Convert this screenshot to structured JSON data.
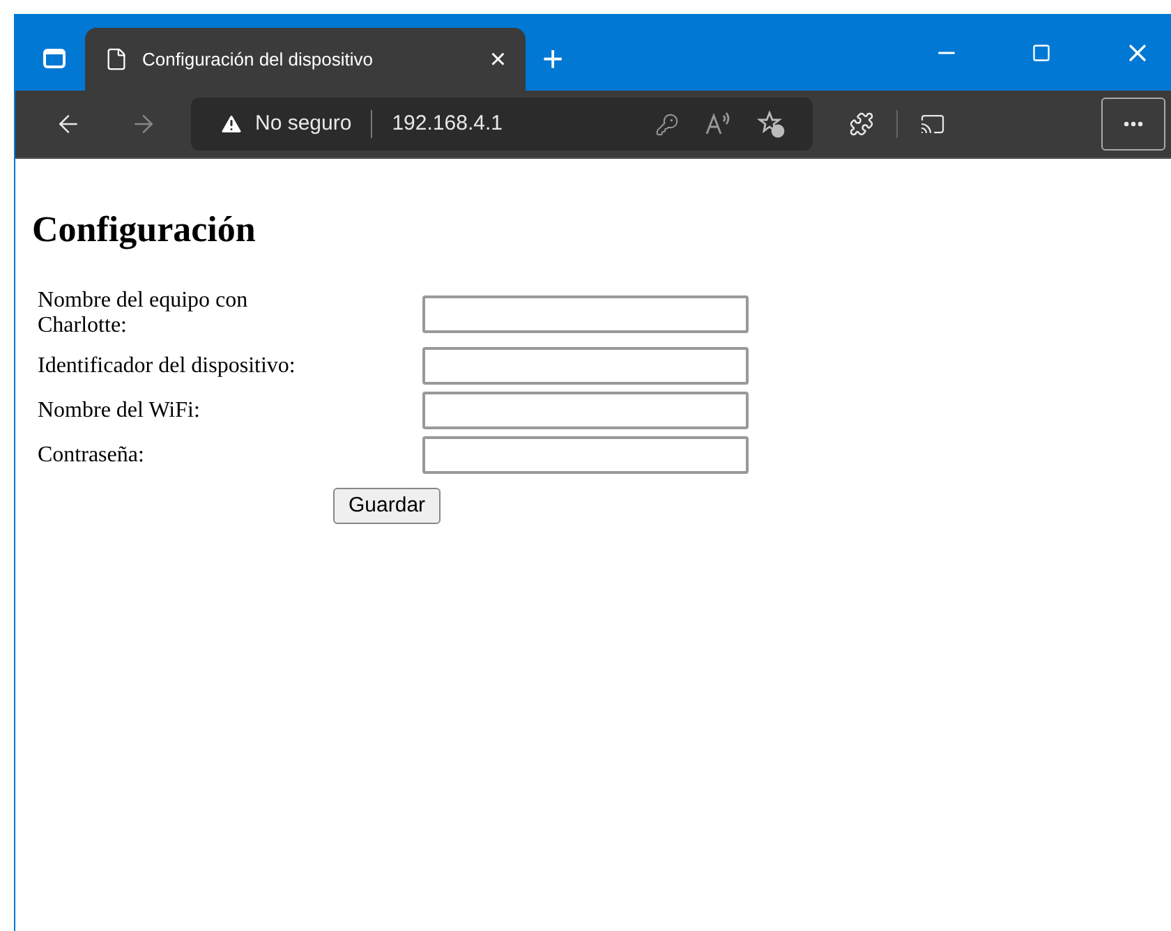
{
  "browser": {
    "tab": {
      "title": "Configuración del dispositivo",
      "close": "×"
    },
    "new_tab": "+",
    "security": "No seguro",
    "url": "192.168.4.1"
  },
  "page": {
    "heading": "Configuración",
    "fields": [
      {
        "label": "Nombre del equipo con Charlotte:"
      },
      {
        "label": "Identificador del dispositivo:"
      },
      {
        "label": "Nombre del WiFi:"
      },
      {
        "label": "Contraseña:"
      }
    ],
    "submit": "Guardar"
  }
}
